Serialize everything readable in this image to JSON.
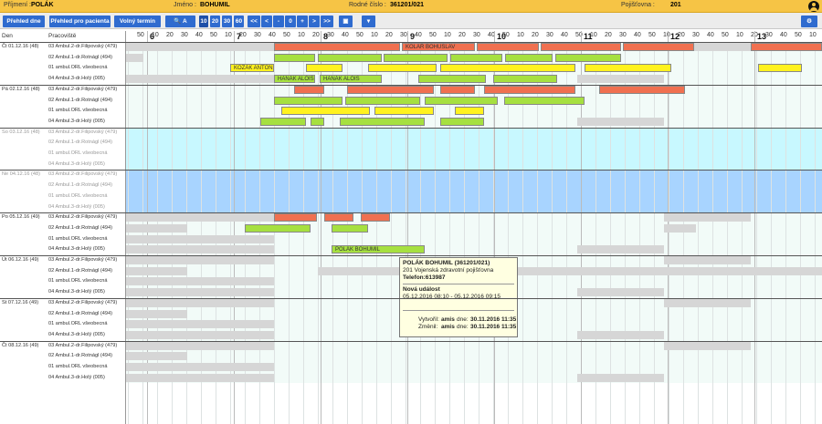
{
  "header": {
    "surname_label": "Příjmení :",
    "surname": "POLÁK",
    "name_label": "Jméno :",
    "name": "BOHUMIL",
    "birth_label": "Rodné číslo :",
    "birth": "361201/021",
    "insurance_label": "Pojišťovna :",
    "insurance": "201"
  },
  "toolbar": {
    "buttons": [
      "Přehled dne",
      "Přehled pro pacienta",
      "Volný termín"
    ],
    "search_label": "A",
    "zoom": [
      "10",
      "20",
      "30",
      "60"
    ],
    "nav": [
      "<<",
      "<",
      "-",
      "0",
      "+",
      ">",
      ">>"
    ]
  },
  "columns": {
    "day": "Den",
    "workplace": "Pracoviště"
  },
  "minute_marks": [
    "0",
    "50",
    "10",
    "20",
    "30",
    "40",
    "50",
    "10",
    "20",
    "30",
    "40",
    "50",
    "10",
    "20",
    "30",
    "40",
    "50",
    "10",
    "20",
    "30",
    "40",
    "50",
    "10",
    "20",
    "30",
    "40",
    "50",
    "10",
    "20",
    "30",
    "40",
    "50",
    "10",
    "20",
    "30",
    "40",
    "50",
    "10",
    "20",
    "30",
    "40",
    "50",
    "10",
    "20",
    "30",
    "40",
    "50",
    "10",
    "20",
    "30",
    "4"
  ],
  "hour_labels": [
    "6",
    "7",
    "8",
    "9",
    "10",
    "11",
    "12",
    "13"
  ],
  "days": [
    {
      "day": "Čt 01.12.16 (48)",
      "weekend": false
    },
    {
      "day": "Pá 02.12.16 (48)",
      "weekend": false
    },
    {
      "day": "So 03.12.16 (48)",
      "weekend": true
    },
    {
      "day": "Ne 04.12.16 (48)",
      "weekend": true
    },
    {
      "day": "Po 05.12.16 (49)",
      "weekend": false
    },
    {
      "day": "Út 06.12.16 (49)",
      "weekend": false
    },
    {
      "day": "St 07.12.16 (49)",
      "weekend": false
    },
    {
      "day": "Čt 08.12.16 (49)",
      "weekend": false
    }
  ],
  "workplaces": [
    "03 Ambul.2-dr.Filipovský (479)",
    "02 Ambul.1-dr.Rotnágl (494)",
    "01 ambul.ORL všeobecná",
    "04 Ambul.3-dr.Holý (005)"
  ],
  "events": [
    {
      "row": 0,
      "s": 300,
      "e": 438,
      "c": "#f07050",
      "t": ""
    },
    {
      "row": 0,
      "s": 440,
      "e": 520,
      "c": "#f07050",
      "t": "KOLÁŘ BOHUSLAV"
    },
    {
      "row": 0,
      "s": 522,
      "e": 590,
      "c": "#f07050",
      "t": ""
    },
    {
      "row": 0,
      "s": 592,
      "e": 680,
      "c": "#f07050",
      "t": ""
    },
    {
      "row": 0,
      "s": 682,
      "e": 760,
      "c": "#f07050",
      "t": ""
    },
    {
      "row": 0,
      "s": 822,
      "e": 900,
      "c": "#f07050",
      "t": ""
    },
    {
      "row": 1,
      "s": 300,
      "e": 345,
      "c": "#a6e040",
      "t": ""
    },
    {
      "row": 1,
      "s": 348,
      "e": 418,
      "c": "#a6e040",
      "t": ""
    },
    {
      "row": 1,
      "s": 420,
      "e": 490,
      "c": "#a6e040",
      "t": ""
    },
    {
      "row": 1,
      "s": 493,
      "e": 550,
      "c": "#a6e040",
      "t": ""
    },
    {
      "row": 1,
      "s": 553,
      "e": 605,
      "c": "#a6e040",
      "t": ""
    },
    {
      "row": 1,
      "s": 608,
      "e": 680,
      "c": "#a6e040",
      "t": ""
    },
    {
      "row": 2,
      "s": 252,
      "e": 300,
      "c": "#fff21e",
      "t": "KOZÁK ANTON"
    },
    {
      "row": 2,
      "s": 335,
      "e": 375,
      "c": "#fff21e",
      "t": ""
    },
    {
      "row": 2,
      "s": 403,
      "e": 478,
      "c": "#fff21e",
      "t": ""
    },
    {
      "row": 2,
      "s": 482,
      "e": 630,
      "c": "#fff21e",
      "t": ""
    },
    {
      "row": 2,
      "s": 640,
      "e": 735,
      "c": "#fff21e",
      "t": ""
    },
    {
      "row": 2,
      "s": 830,
      "e": 878,
      "c": "#fff21e",
      "t": ""
    },
    {
      "row": 3,
      "s": 300,
      "e": 345,
      "c": "#a6e040",
      "t": "HANÁK ALOIS"
    },
    {
      "row": 3,
      "s": 350,
      "e": 418,
      "c": "#a6e040",
      "t": "HANÁK ALOIS"
    },
    {
      "row": 3,
      "s": 458,
      "e": 532,
      "c": "#a6e040",
      "t": ""
    },
    {
      "row": 3,
      "s": 540,
      "e": 610,
      "c": "#a6e040",
      "t": ""
    },
    {
      "row": 4,
      "s": 322,
      "e": 355,
      "c": "#f07050",
      "t": ""
    },
    {
      "row": 4,
      "s": 380,
      "e": 475,
      "c": "#f07050",
      "t": ""
    },
    {
      "row": 4,
      "s": 482,
      "e": 520,
      "c": "#f07050",
      "t": ""
    },
    {
      "row": 4,
      "s": 530,
      "e": 630,
      "c": "#f07050",
      "t": ""
    },
    {
      "row": 4,
      "s": 656,
      "e": 750,
      "c": "#f07050",
      "t": ""
    },
    {
      "row": 5,
      "s": 300,
      "e": 375,
      "c": "#a6e040",
      "t": ""
    },
    {
      "row": 5,
      "s": 378,
      "e": 460,
      "c": "#a6e040",
      "t": ""
    },
    {
      "row": 5,
      "s": 465,
      "e": 545,
      "c": "#a6e040",
      "t": ""
    },
    {
      "row": 5,
      "s": 552,
      "e": 640,
      "c": "#a6e040",
      "t": ""
    },
    {
      "row": 6,
      "s": 308,
      "e": 405,
      "c": "#fff21e",
      "t": ""
    },
    {
      "row": 6,
      "s": 410,
      "e": 475,
      "c": "#fff21e",
      "t": ""
    },
    {
      "row": 6,
      "s": 498,
      "e": 530,
      "c": "#fff21e",
      "t": ""
    },
    {
      "row": 7,
      "s": 285,
      "e": 335,
      "c": "#a6e040",
      "t": ""
    },
    {
      "row": 7,
      "s": 340,
      "e": 355,
      "c": "#a6e040",
      "t": ""
    },
    {
      "row": 7,
      "s": 372,
      "e": 465,
      "c": "#a6e040",
      "t": ""
    },
    {
      "row": 7,
      "s": 482,
      "e": 530,
      "c": "#a6e040",
      "t": ""
    },
    {
      "row": 16,
      "s": 300,
      "e": 347,
      "c": "#f07050",
      "t": ""
    },
    {
      "row": 16,
      "s": 355,
      "e": 387,
      "c": "#f07050",
      "t": ""
    },
    {
      "row": 16,
      "s": 395,
      "e": 427,
      "c": "#f07050",
      "t": ""
    },
    {
      "row": 17,
      "s": 268,
      "e": 340,
      "c": "#a6e040",
      "t": ""
    },
    {
      "row": 17,
      "s": 363,
      "e": 403,
      "c": "#a6e040",
      "t": ""
    },
    {
      "row": 19,
      "s": 363,
      "e": 465,
      "c": "#a6e040",
      "t": "POLÁK BOHUMIL"
    }
  ],
  "gray": [
    {
      "row": 0,
      "s": 138,
      "e": 300
    },
    {
      "row": 0,
      "s": 760,
      "e": 822
    },
    {
      "row": 1,
      "s": 138,
      "e": 157
    },
    {
      "row": 3,
      "s": 138,
      "e": 300
    },
    {
      "row": 3,
      "s": 632,
      "e": 727
    },
    {
      "row": 7,
      "s": 632,
      "e": 727
    },
    {
      "row": 16,
      "s": 138,
      "e": 300
    },
    {
      "row": 16,
      "s": 727,
      "e": 822
    },
    {
      "row": 17,
      "s": 138,
      "e": 205
    },
    {
      "row": 17,
      "s": 727,
      "e": 762
    },
    {
      "row": 18,
      "s": 138,
      "e": 300
    },
    {
      "row": 19,
      "s": 138,
      "e": 300
    },
    {
      "row": 19,
      "s": 632,
      "e": 727
    },
    {
      "row": 20,
      "s": 138,
      "e": 300
    },
    {
      "row": 20,
      "s": 727,
      "e": 822
    },
    {
      "row": 21,
      "s": 138,
      "e": 205
    },
    {
      "row": 21,
      "s": 348,
      "e": 900
    },
    {
      "row": 22,
      "s": 138,
      "e": 300
    },
    {
      "row": 23,
      "s": 138,
      "e": 300
    },
    {
      "row": 23,
      "s": 632,
      "e": 727
    },
    {
      "row": 24,
      "s": 138,
      "e": 300
    },
    {
      "row": 24,
      "s": 727,
      "e": 822
    },
    {
      "row": 25,
      "s": 138,
      "e": 205
    },
    {
      "row": 26,
      "s": 138,
      "e": 300
    },
    {
      "row": 27,
      "s": 138,
      "e": 300
    },
    {
      "row": 27,
      "s": 632,
      "e": 727
    },
    {
      "row": 28,
      "s": 138,
      "e": 300
    },
    {
      "row": 28,
      "s": 727,
      "e": 822
    },
    {
      "row": 29,
      "s": 138,
      "e": 205
    },
    {
      "row": 30,
      "s": 138,
      "e": 300
    },
    {
      "row": 31,
      "s": 138,
      "e": 300
    },
    {
      "row": 31,
      "s": 632,
      "e": 727
    }
  ],
  "tooltip": {
    "title": "POLÁK BOHUMIL (361201/021)",
    "insurer": "201 Vojenská zdravotní pojišťovna",
    "phone": "Telefon:613987",
    "event_title": "Nová událost",
    "event_time": "05.12.2016 08:10 - 05.12.2016 09:15",
    "created_label": "Vytvořil:",
    "created_by": "amis",
    "created_date_label": "dne:",
    "created_date": "30.11.2016 11:35",
    "modified_label": "Změnil:",
    "modified_by": "amis",
    "modified_date_label": "dne:",
    "modified_date": "30.11.2016 11:35"
  },
  "colors": {
    "busy": "#f07050",
    "free": "#a6e040",
    "orl": "#fff21e",
    "weekend_sat": "#c8f8ff",
    "weekend_sun": "#a8d4ff",
    "accent": "#2f6bcf"
  }
}
